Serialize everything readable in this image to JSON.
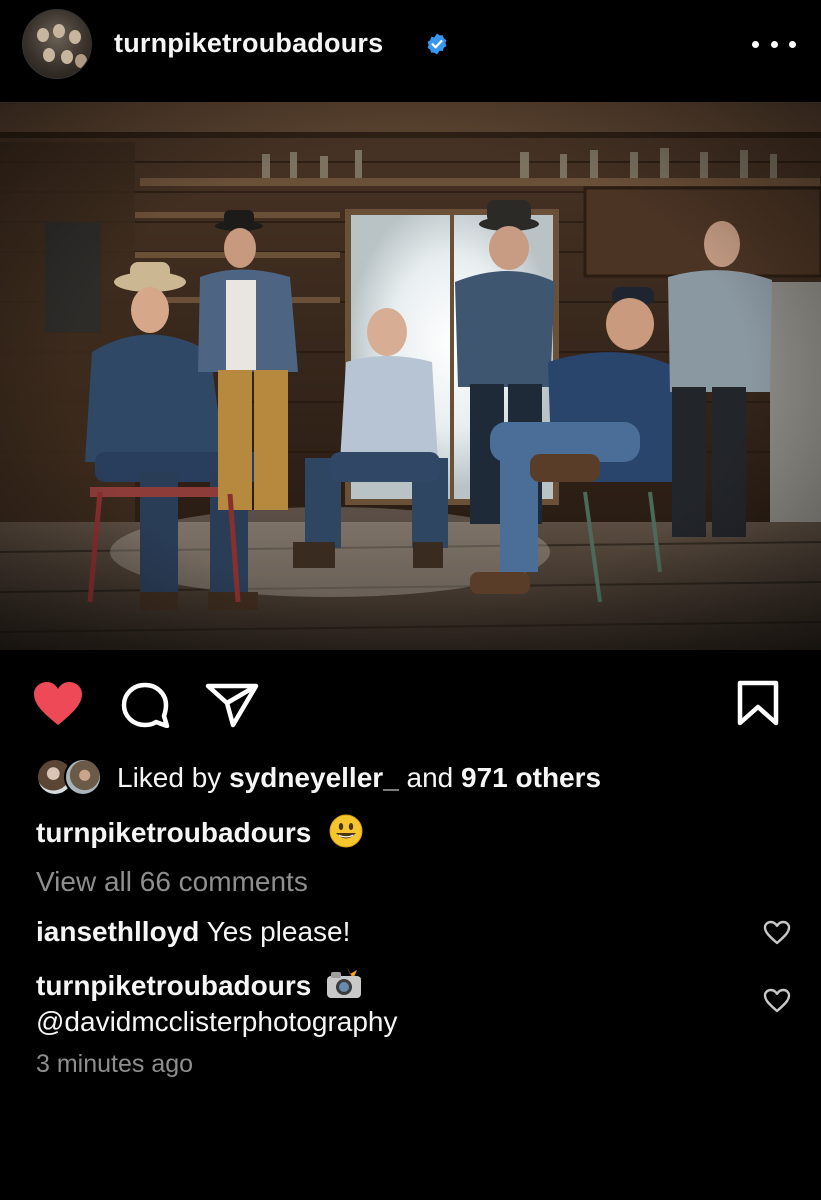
{
  "header": {
    "username": "turnpiketroubadours",
    "verified_icon": "verified-badge-icon",
    "more_icon": "more-options-icon"
  },
  "post": {
    "image_description_icon": "band-photo"
  },
  "actions": {
    "like_icon": "heart-filled-icon",
    "like_color": "#ed4956",
    "comment_icon": "comment-icon",
    "share_icon": "share-icon",
    "save_icon": "bookmark-icon"
  },
  "likes": {
    "prefix": "Liked by",
    "user": "sydneyeller_",
    "joiner": "and",
    "others": "971 others"
  },
  "caption": {
    "username": "turnpiketroubadours",
    "emoji": "smile-emoji"
  },
  "view_all": "View all 66 comments",
  "comments": [
    {
      "username": "iansethlloyd",
      "text": "Yes please!"
    },
    {
      "username": "turnpiketroubadours",
      "emoji": "camera-flash-emoji",
      "text": "@davidmcclisterphotography"
    }
  ],
  "timestamp": "3 minutes ago"
}
